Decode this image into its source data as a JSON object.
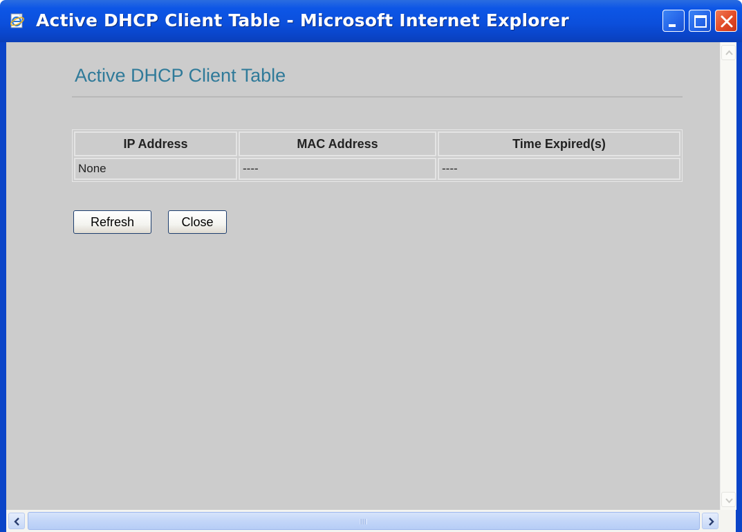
{
  "window": {
    "title": "Active DHCP Client Table - Microsoft Internet Explorer",
    "icon": "ie-page-icon",
    "title_bar_color": "#0b4fdc",
    "controls": [
      "minimize-icon",
      "maximize-icon",
      "close-icon"
    ]
  },
  "page": {
    "title": "Active DHCP Client Table",
    "title_color": "#2f7a99",
    "background": "#cccccc"
  },
  "table": {
    "headers": [
      "IP Address",
      "MAC Address",
      "Time Expired(s)"
    ],
    "rows": [
      [
        "None",
        "----",
        "----"
      ]
    ]
  },
  "buttons": {
    "refresh": "Refresh",
    "close": "Close"
  },
  "scrollbars": {
    "vertical_icons": [
      "scroll-up-icon",
      "scroll-down-icon"
    ],
    "horizontal_icons": [
      "scroll-left-icon",
      "scroll-right-icon"
    ]
  }
}
